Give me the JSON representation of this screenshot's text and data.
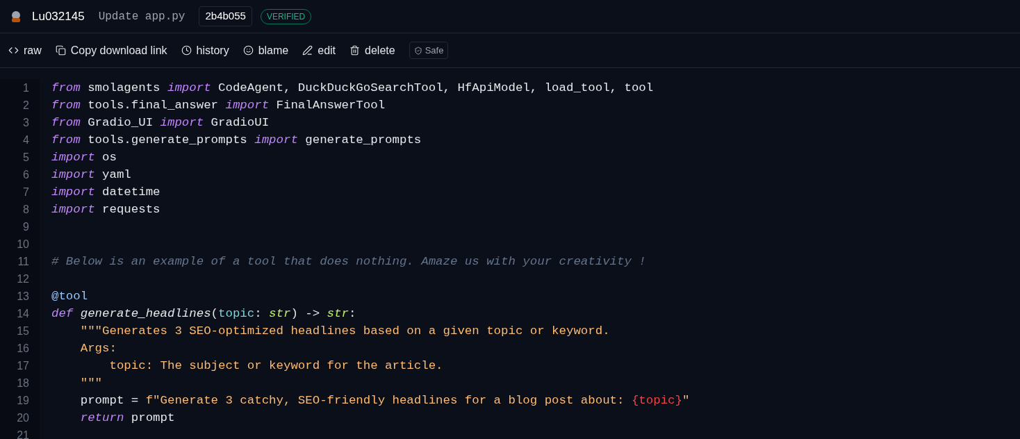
{
  "header": {
    "username": "Lu032145",
    "commit_message": "Update app.py",
    "commit_hash": "2b4b055",
    "badge": "VERIFIED"
  },
  "toolbar": [
    {
      "kind": "raw",
      "label": "raw"
    },
    {
      "kind": "copy",
      "label": "Copy download link"
    },
    {
      "kind": "history",
      "label": "history"
    },
    {
      "kind": "blame",
      "label": "blame"
    },
    {
      "kind": "edit",
      "label": "edit"
    },
    {
      "kind": "delete",
      "label": "delete"
    }
  ],
  "safe_badge": "Safe",
  "code_lines": [
    {
      "number": "1",
      "tokens": [
        {
          "kind": "keyword",
          "text": "from"
        },
        {
          "kind": "plain",
          "text": " smolagents "
        },
        {
          "kind": "keyword",
          "text": "import"
        },
        {
          "kind": "plain",
          "text": " CodeAgent, DuckDuckGoSearchTool, HfApiModel, load_tool, tool"
        }
      ]
    },
    {
      "number": "2",
      "tokens": [
        {
          "kind": "keyword",
          "text": "from"
        },
        {
          "kind": "plain",
          "text": " tools.final_answer "
        },
        {
          "kind": "keyword",
          "text": "import"
        },
        {
          "kind": "plain",
          "text": " FinalAnswerTool"
        }
      ]
    },
    {
      "number": "3",
      "tokens": [
        {
          "kind": "keyword",
          "text": "from"
        },
        {
          "kind": "plain",
          "text": " Gradio_UI "
        },
        {
          "kind": "keyword",
          "text": "import"
        },
        {
          "kind": "plain",
          "text": " GradioUI"
        }
      ]
    },
    {
      "number": "4",
      "tokens": [
        {
          "kind": "keyword",
          "text": "from"
        },
        {
          "kind": "plain",
          "text": " tools.generate_prompts "
        },
        {
          "kind": "keyword",
          "text": "import"
        },
        {
          "kind": "plain",
          "text": " generate_prompts"
        }
      ]
    },
    {
      "number": "5",
      "tokens": [
        {
          "kind": "keyword",
          "text": "import"
        },
        {
          "kind": "plain",
          "text": " os"
        }
      ]
    },
    {
      "number": "6",
      "tokens": [
        {
          "kind": "keyword",
          "text": "import"
        },
        {
          "kind": "plain",
          "text": " yaml"
        }
      ]
    },
    {
      "number": "7",
      "tokens": [
        {
          "kind": "keyword",
          "text": "import"
        },
        {
          "kind": "plain",
          "text": " datetime"
        }
      ]
    },
    {
      "number": "8",
      "tokens": [
        {
          "kind": "keyword",
          "text": "import"
        },
        {
          "kind": "plain",
          "text": " requests"
        }
      ]
    },
    {
      "number": "9"
    },
    {
      "number": "10"
    },
    {
      "number": "11",
      "tokens": [
        {
          "kind": "comment",
          "text": "# Below is an example of a tool that does nothing. Amaze us with your creativity !"
        }
      ]
    },
    {
      "number": "12"
    },
    {
      "number": "13",
      "tokens": [
        {
          "kind": "decorator",
          "text": "@tool"
        }
      ]
    },
    {
      "number": "14",
      "tokens": [
        {
          "kind": "keyword",
          "text": "def"
        },
        {
          "kind": "function",
          "text": " generate_headlines"
        },
        {
          "kind": "plain",
          "text": "("
        },
        {
          "kind": "param",
          "text": "topic"
        },
        {
          "kind": "plain",
          "text": ": "
        },
        {
          "kind": "type",
          "text": "str"
        },
        {
          "kind": "plain",
          "text": ") -> "
        },
        {
          "kind": "type",
          "text": "str"
        },
        {
          "kind": "plain",
          "text": ":"
        }
      ]
    },
    {
      "number": "15",
      "tokens": [
        {
          "kind": "string",
          "text": "    \"\"\"Generates 3 SEO-optimized headlines based on a given topic or keyword."
        }
      ]
    },
    {
      "number": "16",
      "tokens": [
        {
          "kind": "string",
          "text": "    Args:"
        }
      ]
    },
    {
      "number": "17",
      "tokens": [
        {
          "kind": "string",
          "text": "        topic: The subject or keyword for the article."
        }
      ]
    },
    {
      "number": "18",
      "tokens": [
        {
          "kind": "string",
          "text": "    \"\"\""
        }
      ]
    },
    {
      "number": "19",
      "tokens": [
        {
          "kind": "plain",
          "text": "    prompt = "
        },
        {
          "kind": "string",
          "text": "f\"Generate 3 catchy, SEO-friendly headlines for a blog post about: "
        },
        {
          "kind": "interp",
          "text": "{topic}"
        },
        {
          "kind": "string",
          "text": "\""
        }
      ]
    },
    {
      "number": "20",
      "tokens": [
        {
          "kind": "keyword",
          "text": "    return"
        },
        {
          "kind": "plain",
          "text": " prompt"
        }
      ]
    },
    {
      "number": "21"
    }
  ]
}
